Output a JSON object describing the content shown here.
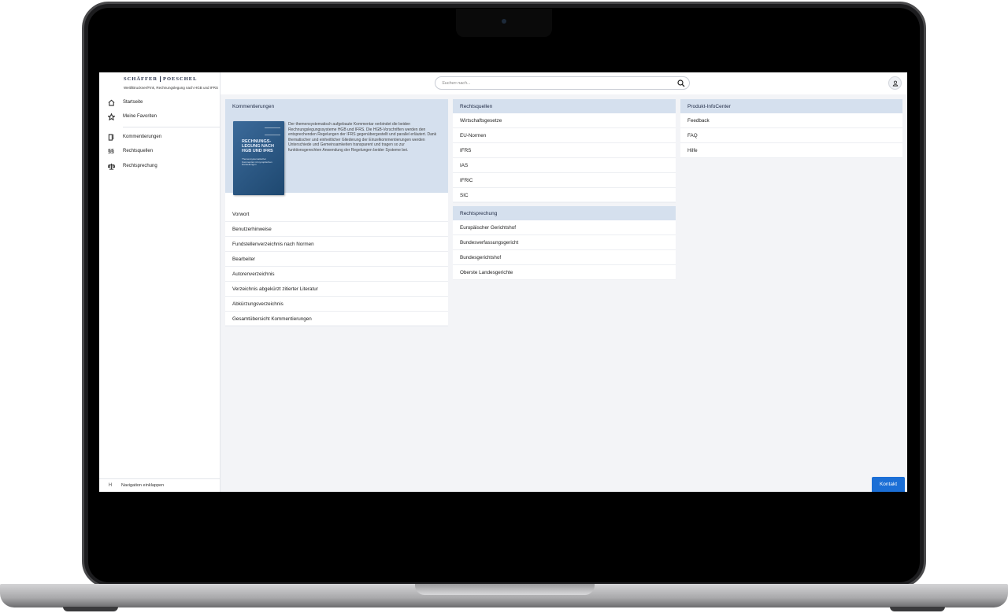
{
  "brand": {
    "left": "SCHÄFFER",
    "right": "POESCHEL",
    "subtitle": "Weitl/Bruckner/Fink, Rechnungslegung nach HGB und IFRS"
  },
  "sidebar": {
    "items": [
      {
        "label": "Startseite",
        "icon": "home-icon"
      },
      {
        "label": "Meine Favoriten",
        "icon": "star-icon"
      },
      {
        "label": "Kommentierungen",
        "icon": "book-icon"
      },
      {
        "label": "Rechtsquellen",
        "icon": "paragraph-icon"
      },
      {
        "label": "Rechtsprechung",
        "icon": "scales-icon"
      }
    ],
    "collapse_icon": "H",
    "collapse_label": "Navigation einklappen"
  },
  "search": {
    "placeholder": "Suchen nach..."
  },
  "kommentierungen": {
    "header": "Kommentierungen",
    "book_title": "RECHNUNGS-LEGUNG NACH HGB UND IFRS",
    "book_subtitle": "Themensystematischer Kommentar mit synoptischen Darstellungen",
    "description": "Der themensystematisch aufgebaute Kommentar verbindet die beiden Rechnungslegungssysteme HGB und IFRS. Die HGB-Vorschriften werden den entsprechenden Regelungen der IFRS gegenübergestellt und parallel erläutert. Dank thematischer und einheitlicher Gliederung der Einzelkommentierungen werden Unterschiede und Gemeinsamkeiten transparent und tragen so zur funktionsgerechten Anwendung der Regelungen beider Systeme bei.",
    "items": [
      "Vorwort",
      "Benutzerhinweise",
      "Fundstellenverzeichnis nach Normen",
      "Bearbeiter",
      "Autorenverzeichnis",
      "Verzeichnis abgekürzt zitierter Literatur",
      "Abkürzungsverzeichnis",
      "Gesamtübersicht Kommentierungen"
    ]
  },
  "rechtsquellen": {
    "header": "Rechtsquellen",
    "items": [
      "Wirtschaftsgesetze",
      "EU-Normen",
      "IFRS",
      "IAS",
      "IFRIC",
      "SIC"
    ]
  },
  "rechtsprechung": {
    "header": "Rechtsprechung",
    "items": [
      "Europäischer Gerichtshof",
      "Bundesverfassungsgericht",
      "Bundesgerichtshof",
      "Oberste Landesgerichte"
    ]
  },
  "infocenter": {
    "header": "Produkt-InfoCenter",
    "items": [
      "Feedback",
      "FAQ",
      "Hilfe"
    ]
  },
  "kontakt_label": "Kontakt",
  "colors": {
    "accent": "#1b6fd6",
    "panel_header": "#d5e0ee",
    "brand": "#1f2a44"
  }
}
